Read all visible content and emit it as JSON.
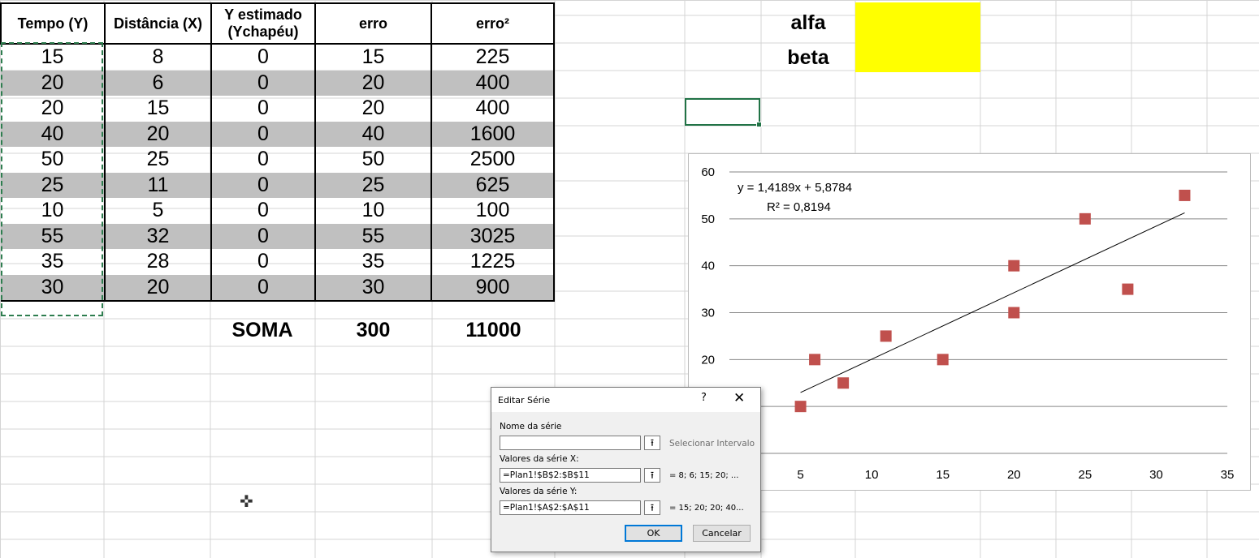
{
  "table": {
    "headers": [
      "Tempo (Y)",
      "Distância (X)",
      "Y estimado (Ychapéu)",
      "erro",
      "erro²"
    ],
    "rows": [
      [
        "15",
        "8",
        "0",
        "15",
        "225"
      ],
      [
        "20",
        "6",
        "0",
        "20",
        "400"
      ],
      [
        "20",
        "15",
        "0",
        "20",
        "400"
      ],
      [
        "40",
        "20",
        "0",
        "40",
        "1600"
      ],
      [
        "50",
        "25",
        "0",
        "50",
        "2500"
      ],
      [
        "25",
        "11",
        "0",
        "25",
        "625"
      ],
      [
        "10",
        "5",
        "0",
        "10",
        "100"
      ],
      [
        "55",
        "32",
        "0",
        "55",
        "3025"
      ],
      [
        "35",
        "28",
        "0",
        "35",
        "1225"
      ],
      [
        "30",
        "20",
        "0",
        "30",
        "900"
      ]
    ],
    "sum_label": "SOMA",
    "sum_erro": "300",
    "sum_erro2": "11000"
  },
  "params": {
    "alfa_label": "alfa",
    "beta_label": "beta",
    "highlight_color": "#ffff00"
  },
  "chart_data": {
    "type": "scatter",
    "x": [
      8,
      6,
      15,
      20,
      25,
      11,
      5,
      32,
      28,
      20
    ],
    "y": [
      15,
      20,
      20,
      40,
      50,
      25,
      10,
      55,
      35,
      30
    ],
    "xlim": [
      0,
      35
    ],
    "ylim": [
      0,
      60
    ],
    "xticks": [
      "5",
      "10",
      "15",
      "20",
      "25",
      "30",
      "35"
    ],
    "yticks": [
      "20",
      "30",
      "40",
      "50",
      "60"
    ],
    "trendline": {
      "slope": 1.4189,
      "intercept": 5.8784,
      "x_range": [
        5,
        32
      ]
    },
    "equation": "y = 1,4189x + 5,8784",
    "r2": "R² = 0,8194",
    "marker_color": "#c0504d",
    "grid": true
  },
  "dialog": {
    "title": "Editar Série",
    "help": "?",
    "close": "✕",
    "name_label": "Nome da série",
    "name_value": "",
    "name_hint": "Selecionar Intervalo",
    "x_label": "Valores da série X:",
    "x_value": "=Plan1!$B$2:$B$11",
    "x_preview": "= 8; 6; 15; 20; ...",
    "y_label": "Valores da série Y:",
    "y_value": "=Plan1!$A$2:$A$11",
    "y_preview": "= 15; 20; 20; 40...",
    "ok": "OK",
    "cancel": "Cancelar"
  }
}
